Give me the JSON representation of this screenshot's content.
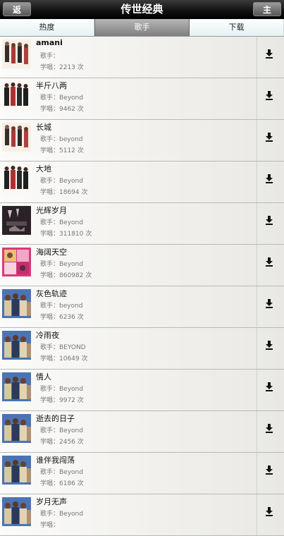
{
  "header": {
    "title": "传世经典",
    "back_label": "返回",
    "home_label": "主页"
  },
  "tabs": [
    {
      "label": "热度",
      "active": false
    },
    {
      "label": "歌手",
      "active": true
    },
    {
      "label": "下载",
      "active": false
    }
  ],
  "songs": [
    {
      "title": "amani",
      "singer": "歌手：",
      "count": "学唱：2213 次",
      "thumb": "band-light"
    },
    {
      "title": "半斤八两",
      "singer": "歌手：Beyond",
      "count": "学唱：9462 次",
      "thumb": "band-dark"
    },
    {
      "title": "长城",
      "singer": "歌手：beyond",
      "count": "学唱：5112 次",
      "thumb": "band-light"
    },
    {
      "title": "大地",
      "singer": "歌手：Beyond",
      "count": "学唱：18694 次",
      "thumb": "band-dark"
    },
    {
      "title": "光辉岁月",
      "singer": "歌手：Beyond",
      "count": "学唱：311810 次",
      "thumb": "album-dark"
    },
    {
      "title": "海阔天空",
      "singer": "歌手：Beyond",
      "count": "学唱：860982 次",
      "thumb": "album-pink"
    },
    {
      "title": "灰色轨迹",
      "singer": "歌手：beyond",
      "count": "学唱：6236 次",
      "thumb": "group-blue"
    },
    {
      "title": "冷雨夜",
      "singer": "歌手：BEYOND",
      "count": "学唱：10649 次",
      "thumb": "group-blue"
    },
    {
      "title": "情人",
      "singer": "歌手：Beyond",
      "count": "学唱：9972 次",
      "thumb": "group-blue"
    },
    {
      "title": "逝去的日子",
      "singer": "歌手：Beyond",
      "count": "学唱：2456 次",
      "thumb": "group-blue"
    },
    {
      "title": "谁伴我闯荡",
      "singer": "歌手：Beyond",
      "count": "学唱：6186 次",
      "thumb": "group-blue"
    },
    {
      "title": "岁月无声",
      "singer": "歌手：Beyond",
      "count": "学唱：",
      "thumb": "group-blue"
    }
  ],
  "icons": {
    "download": "download-arrow-icon"
  },
  "colors": {
    "header": "#111111",
    "active_tab": "#8a8a8a",
    "tab": "#f2f8f9",
    "row": "#f3f2ef"
  }
}
